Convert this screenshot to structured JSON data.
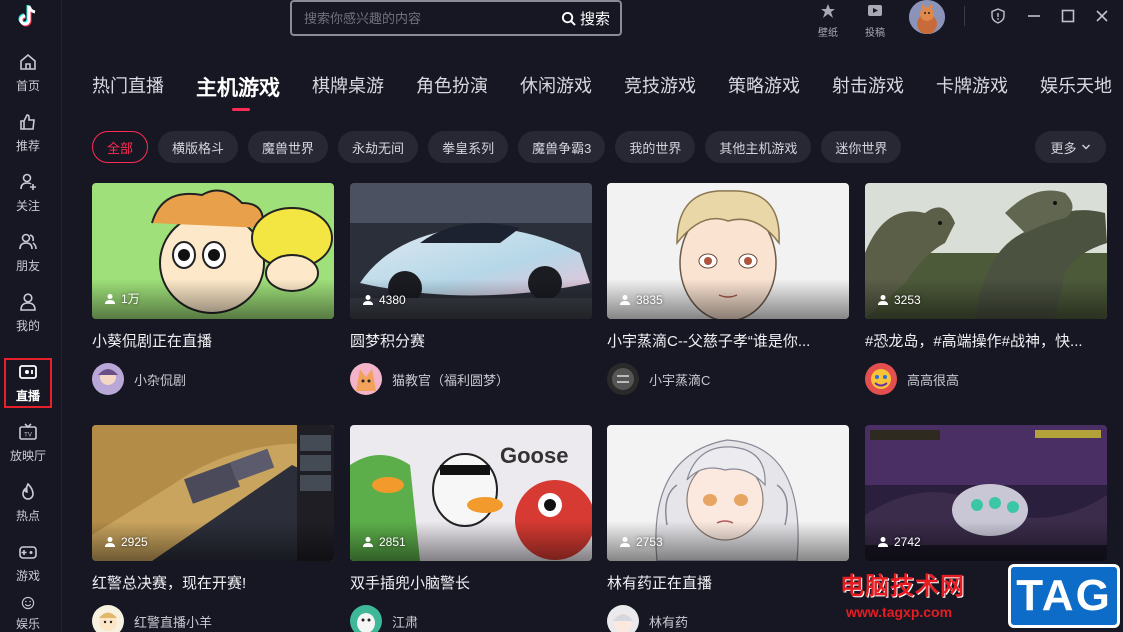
{
  "sidebar": {
    "items": [
      {
        "label": "首页",
        "icon": "home-icon"
      },
      {
        "label": "推荐",
        "icon": "thumbs-up-icon"
      },
      {
        "label": "关注",
        "icon": "follow-user-icon"
      },
      {
        "label": "朋友",
        "icon": "friends-icon"
      },
      {
        "label": "我的",
        "icon": "profile-icon"
      },
      {
        "label": "直播",
        "icon": "live-icon"
      },
      {
        "label": "放映厅",
        "icon": "tv-icon"
      },
      {
        "label": "热点",
        "icon": "flame-icon"
      },
      {
        "label": "游戏",
        "icon": "gamepad-icon"
      },
      {
        "label": "娱乐",
        "icon": "smile-icon"
      }
    ],
    "active": "直播"
  },
  "header": {
    "search_placeholder": "搜索你感兴趣的内容",
    "search_button": "搜索",
    "wallpaper_label": "壁纸",
    "upload_label": "投稿"
  },
  "tabs": [
    "热门直播",
    "主机游戏",
    "棋牌桌游",
    "角色扮演",
    "休闲游戏",
    "竞技游戏",
    "策略游戏",
    "射击游戏",
    "卡牌游戏",
    "娱乐天地"
  ],
  "active_tab": "主机游戏",
  "chips": [
    "全部",
    "横版格斗",
    "魔兽世界",
    "永劫无间",
    "拳皇系列",
    "魔兽争霸3",
    "我的世界",
    "其他主机游戏",
    "迷你世界"
  ],
  "active_chip": "全部",
  "more_label": "更多",
  "cards": [
    {
      "viewers": "1万",
      "title": "小葵侃剧正在直播",
      "author": "小杂侃剧"
    },
    {
      "viewers": "4380",
      "title": "圆梦积分赛",
      "author": "猫教官（福利圆梦）"
    },
    {
      "viewers": "3835",
      "title": "小宇蒸滴C--父慈子孝“谁是你...",
      "author": "小宇蒸滴C"
    },
    {
      "viewers": "3253",
      "title": "#恐龙岛，#高端操作#战神，快...",
      "author": "高高很高"
    },
    {
      "viewers": "2925",
      "title": "红警总决赛，现在开赛!",
      "author": "红警直播小羊"
    },
    {
      "viewers": "2851",
      "title": "双手插兜小脑警长",
      "author": "江肃"
    },
    {
      "viewers": "2753",
      "title": "林有药正在直播",
      "author": "林有药"
    },
    {
      "viewers": "2742",
      "title": "",
      "author": ""
    }
  ],
  "watermark": {
    "text": "电脑技术网",
    "url": "www.tagxp.com",
    "tag": "TAG"
  },
  "colors": {
    "background": "#161722",
    "accent": "#fe2c55",
    "active_border": "#e8202b",
    "chip_bg": "#272834"
  }
}
